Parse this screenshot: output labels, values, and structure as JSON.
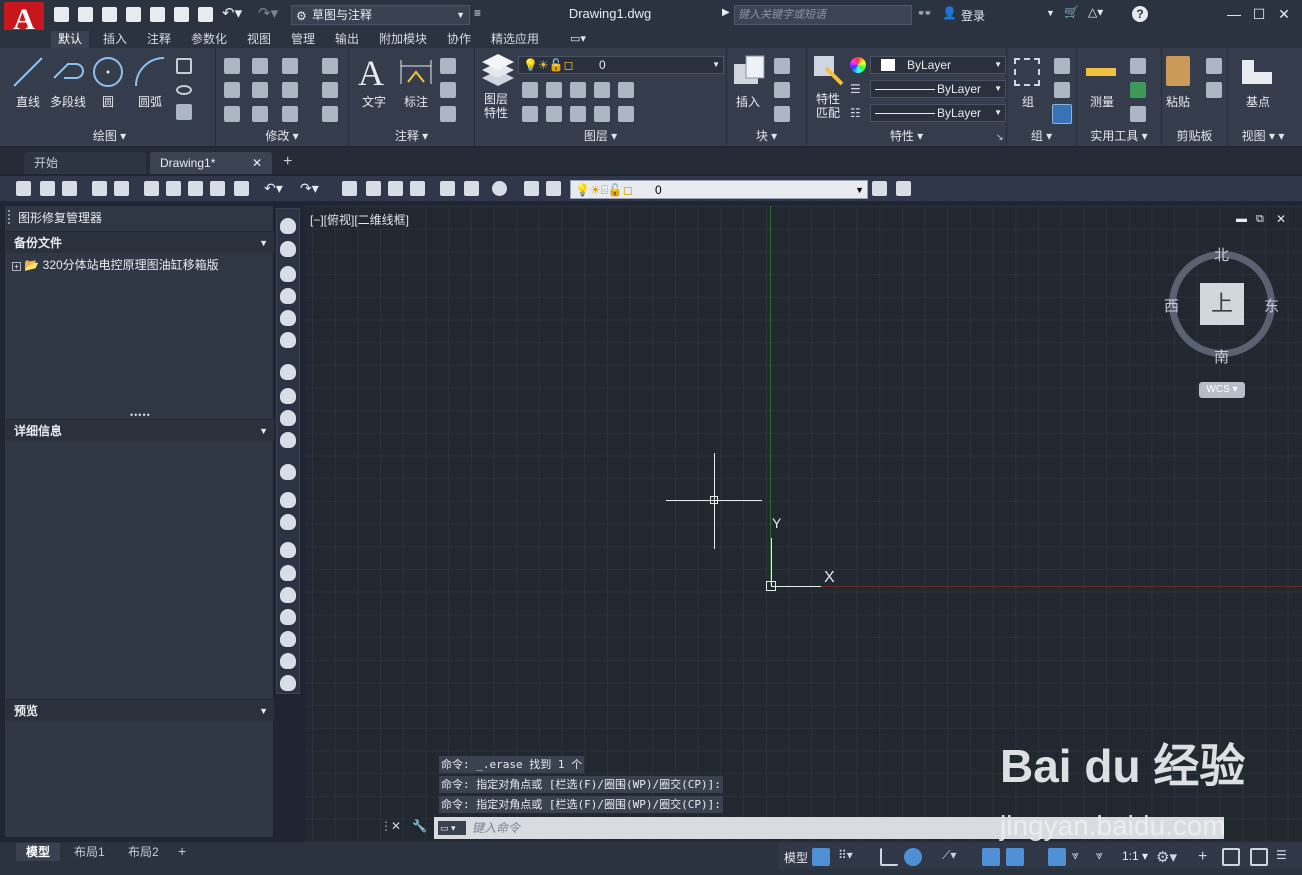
{
  "titlebar": {
    "workspace": "草图与注释",
    "file_title": "Drawing1.dwg",
    "search_placeholder": "键入关键字或短语",
    "login": "登录"
  },
  "ribbon_tabs": [
    "默认",
    "插入",
    "注释",
    "参数化",
    "视图",
    "管理",
    "输出",
    "附加模块",
    "协作",
    "精选应用"
  ],
  "ribbon": {
    "draw": {
      "line": "直线",
      "polyline": "多段线",
      "circle": "圆",
      "arc": "圆弧",
      "panel": "绘图"
    },
    "modify": {
      "panel": "修改"
    },
    "annotation": {
      "text": "文字",
      "dimension": "标注",
      "panel": "注释"
    },
    "layers": {
      "layer_props": "图层\n特性",
      "current_layer": "0",
      "panel": "图层"
    },
    "block": {
      "insert": "插入",
      "panel": "块"
    },
    "properties": {
      "match": "特性\n匹配",
      "color": "ByLayer",
      "linetype": "ByLayer",
      "lineweight": "ByLayer",
      "panel": "特性"
    },
    "groups": {
      "group": "组",
      "panel": "组"
    },
    "utilities": {
      "measure": "测量",
      "panel": "实用工具"
    },
    "clipboard": {
      "paste": "粘贴",
      "panel": "剪贴板"
    },
    "view": {
      "basepoint": "基点",
      "panel": "视图"
    }
  },
  "doc_tabs": {
    "start": "开始",
    "drawing": "Drawing1*"
  },
  "toolbar2": {
    "layer": "0"
  },
  "palette": {
    "title": "图形修复管理器",
    "backup_header": "备份文件",
    "backup_item": "320分体站电控原理图油缸移箱版",
    "details_header": "详细信息",
    "preview_header": "预览"
  },
  "viewport": {
    "label": "[−][俯视][二维线框]",
    "y_axis": "Y",
    "x_axis": "X"
  },
  "viewcube": {
    "north": "北",
    "south": "南",
    "east": "东",
    "west": "西",
    "top": "上",
    "wcs": "WCS"
  },
  "command": {
    "history": [
      "命令: _.erase 找到 1 个",
      "命令: 指定对角点或 [栏选(F)/圈围(WP)/圈交(CP)]:",
      "命令: 指定对角点或 [栏选(F)/圈围(WP)/圈交(CP)]:"
    ],
    "placeholder": "键入命令"
  },
  "layout_tabs": [
    "模型",
    "布局1",
    "布局2"
  ],
  "status": {
    "model": "模型",
    "scale": "1:1"
  },
  "watermark": {
    "logo": "Bai du 经验",
    "url": "jingyan.baidu.com"
  }
}
